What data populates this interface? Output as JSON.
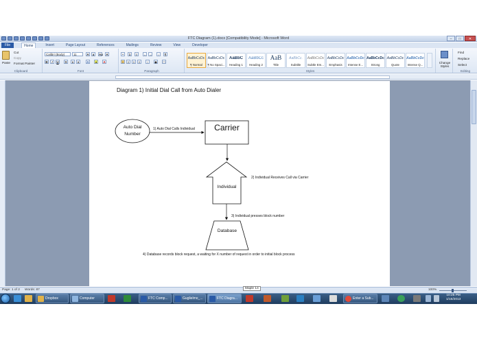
{
  "window": {
    "title": "FTC Diagram (1).docx [Compatibility Mode] - Microsoft Word",
    "buttons": [
      "–",
      "□",
      "✕"
    ]
  },
  "tabs": [
    "File",
    "Home",
    "Insert",
    "Page Layout",
    "References",
    "Mailings",
    "Review",
    "View",
    "Developer"
  ],
  "ribbon": {
    "clipboard": {
      "paste": "Paste",
      "cut": "Cut",
      "copy": "Copy",
      "format_painter": "Format Painter",
      "label": "Clipboard"
    },
    "font": {
      "name": "Calibri (Body)",
      "size": "11",
      "label": "Font"
    },
    "paragraph": {
      "label": "Paragraph"
    },
    "styles": {
      "label": "Styles",
      "items": [
        {
          "sample": "AaBbCcDc",
          "name": "¶ Normal"
        },
        {
          "sample": "AaBbCcDc",
          "name": "¶ No Spaci..."
        },
        {
          "sample": "AaBbC",
          "name": "Heading 1"
        },
        {
          "sample": "AaBbCc",
          "name": "Heading 2"
        },
        {
          "sample": "AaB",
          "name": "Title"
        },
        {
          "sample": "AaBbCc.",
          "name": "Subtitle"
        },
        {
          "sample": "AaBbCcDc",
          "name": "Subtle Em..."
        },
        {
          "sample": "AaBbCcDc",
          "name": "Emphasis"
        },
        {
          "sample": "AaBbCcDc",
          "name": "Intense E..."
        },
        {
          "sample": "AaBbCcDc",
          "name": "Strong"
        },
        {
          "sample": "AaBbCcDc",
          "name": "Quote"
        },
        {
          "sample": "AaBbCcDc",
          "name": "Intense Q..."
        }
      ],
      "change_styles": "Change Styles"
    },
    "editing": {
      "find": "Find",
      "replace": "Replace",
      "select": "Select",
      "label": "Editing"
    }
  },
  "document": {
    "title": "Diagram 1) Initial Dial Call from Auto Dialer",
    "nodes": {
      "auto_dial": "Auto Dial Number",
      "carrier": "Carrier",
      "individual": "Individual",
      "database": "Database"
    },
    "steps": [
      "1) Auto Dial Calls Individual",
      "2) Individual Receives Call via Carrier",
      "3) Individual presses block number",
      "4) Database records block request, a waiting for X number of request in order to initial block process"
    ]
  },
  "statusbar": {
    "page": "Page: 1 of 2",
    "words": "Words: 87",
    "tooltip": "Maple 14",
    "zoom": "100%"
  },
  "taskbar": {
    "buttons": [
      "Dropbox",
      "Computer",
      "FTC Comp...",
      "Guglielmo_...",
      "FTC Diagra...",
      "Enter a Sub..."
    ],
    "time": "10:25 PM",
    "date": "1/16/2013"
  },
  "colors": {
    "ribbon_bg": "#dde7f4",
    "file_tab": "#2a5aa6",
    "workspace": "#8c9bb2",
    "taskbar": "#2a4a70"
  }
}
